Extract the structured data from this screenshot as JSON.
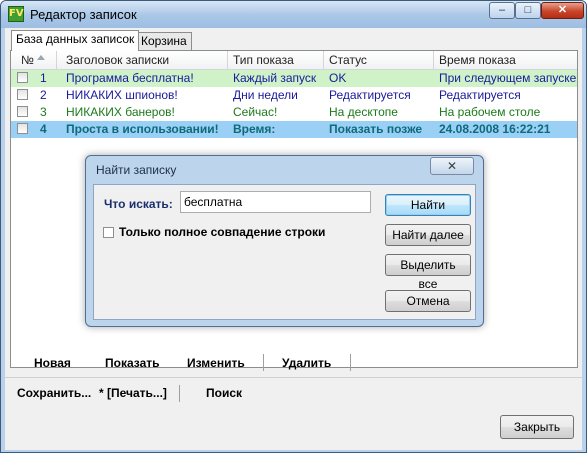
{
  "window": {
    "title": "Редактор записок",
    "app_icon_text": "FV",
    "min_icon": "minimize-icon",
    "max_icon": "maximize-icon",
    "close_icon": "close-icon",
    "min_glyph": "–",
    "max_glyph": "□",
    "close_glyph": "✕"
  },
  "tabs": [
    {
      "label": "База данных записок",
      "active": true
    },
    {
      "label": "Корзина",
      "active": false
    }
  ],
  "list": {
    "columns": [
      "№",
      "Заголовок записки",
      "Тип показа",
      "Статус",
      "Время показа"
    ],
    "rows": [
      {
        "num": "1",
        "title": "Программа бесплатна!",
        "type": "Каждый запуск",
        "status": "OK",
        "time": "При следующем запуске",
        "bg": "#cff2c9",
        "color": "#1a1a9a",
        "checked": false,
        "selected": false
      },
      {
        "num": "2",
        "title": "НИКАКИХ шпионов!",
        "type": "Дни недели",
        "status": "Редактируется",
        "time": "Редактируется",
        "bg": "#ffffff",
        "color": "#1a1a9a",
        "checked": false,
        "selected": false
      },
      {
        "num": "3",
        "title": "НИКАКИХ банеров!",
        "type": "Сейчас!",
        "status": "На десктопе",
        "time": "На рабочем столе",
        "bg": "#ffffff",
        "color": "#1b7a1b",
        "checked": false,
        "selected": false
      },
      {
        "num": "4",
        "title": "Проста в использовании!",
        "type": "Время:",
        "status": "Показать позже",
        "time": "24.08.2008 16:22:21",
        "bg": "#9ad0f5",
        "color": "#0d6a7a",
        "checked": false,
        "selected": true
      }
    ]
  },
  "find_dialog": {
    "title": "Найти записку",
    "close_glyph": "✕",
    "search_label": "Что искать:",
    "search_value": "бесплатна",
    "match_label": "Только полное совпадение строки",
    "match_checked": false,
    "buttons": {
      "find": "Найти",
      "find_next": "Найти далее",
      "select_all": "Выделить все",
      "cancel": "Отмена"
    }
  },
  "toolbar1": {
    "new": "Новая",
    "show": "Показать",
    "edit": "Изменить",
    "delete": "Удалить"
  },
  "toolbar2": {
    "save": "Сохранить...",
    "print": "* [Печать...]",
    "search": "Поиск"
  },
  "footer": {
    "close": "Закрыть"
  }
}
